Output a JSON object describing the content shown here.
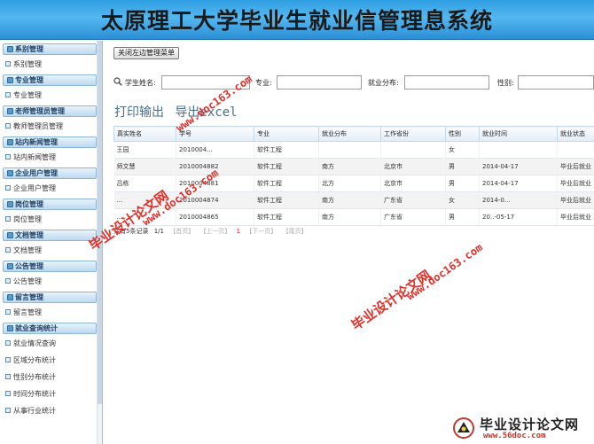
{
  "header": {
    "title": "太原理工大学毕业生就业信管理息系统"
  },
  "sidebar": {
    "groups": [
      {
        "title": "系别管理",
        "items": [
          "系别管理"
        ]
      },
      {
        "title": "专业管理",
        "items": [
          "专业管理"
        ]
      },
      {
        "title": "老师管理员管理",
        "items": [
          "教师管理员管理"
        ]
      },
      {
        "title": "站内新闻管理",
        "items": [
          "站内新闻管理"
        ]
      },
      {
        "title": "企业用户管理",
        "items": [
          "企业用户管理"
        ]
      },
      {
        "title": "岗位管理",
        "items": [
          "岗位管理"
        ]
      },
      {
        "title": "文档管理",
        "items": [
          "文档管理"
        ]
      },
      {
        "title": "公告管理",
        "items": [
          "公告管理"
        ]
      },
      {
        "title": "留言管理",
        "items": [
          "留言管理"
        ]
      },
      {
        "title": "就业查询统计",
        "items": [
          "就业情况查询",
          "区域分布统计",
          "性别分布统计",
          "时间分布统计",
          "从事行业统计"
        ]
      }
    ]
  },
  "toolbar": {
    "close_menu_label": "关闭左边管理菜单"
  },
  "search": {
    "name_label": "学生姓名:",
    "major_label": "专业:",
    "distribution_label": "就业分布:",
    "gender_label": "性别:",
    "name_value": "",
    "major_value": "",
    "distribution_value": "",
    "gender_value": ""
  },
  "export": {
    "print_label": "打印输出",
    "excel_label": "导出excel"
  },
  "table": {
    "headers": [
      "真实姓名",
      "学号",
      "专业",
      "就业分布",
      "工作省份",
      "性别",
      "就业时间",
      "就业状态"
    ],
    "rows": [
      [
        "王园",
        "2010004...",
        "软件工程",
        "",
        "",
        "女",
        "",
        ""
      ],
      [
        "师文慧",
        "2010004882",
        "软件工程",
        "南方",
        "北京市",
        "男",
        "2014-04-17",
        "毕业后就业"
      ],
      [
        "吕栋",
        "2010004881",
        "软件工程",
        "北方",
        "北京市",
        "男",
        "2014-04-17",
        "毕业后就业"
      ],
      [
        "...",
        "2010004874",
        "软件工程",
        "南方",
        "广东省",
        "女",
        "2014-0...",
        "毕业后就业"
      ],
      [
        "...",
        "2010004865",
        "软件工程",
        "南方",
        "广东省",
        "男",
        "20..-05-17",
        "毕业后就业"
      ]
    ]
  },
  "pager": {
    "total": "共有5条记录",
    "page": "1/1",
    "first": "【首页】",
    "prev": "【上一页】",
    "current": "1",
    "next": "【下一页】",
    "last": "【尾页】"
  },
  "watermarks": {
    "cn": "毕业设计论文网",
    "url": "www.doc163.com",
    "brand_cn": "毕业设计论文网",
    "brand_url": "www.56doc.com"
  },
  "colors": {
    "header_blue": "#2f9fe3",
    "watermark_red": "#e0302a",
    "pager_current": "#d02020"
  }
}
